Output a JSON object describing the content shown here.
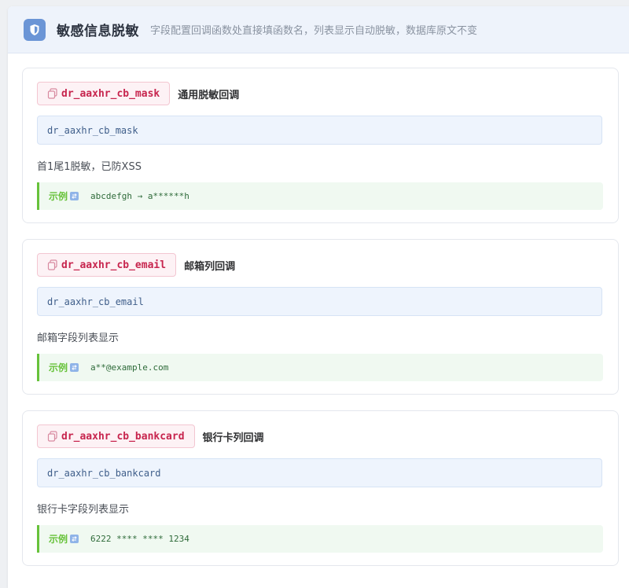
{
  "header": {
    "title": "敏感信息脱敏",
    "subtitle": "字段配置回调函数处直接填函数名，列表显示自动脱敏，数据库原文不变",
    "icon": "shield-icon",
    "accent": "#6b95d6"
  },
  "cards": [
    {
      "fn_name": "dr_aaxhr_cb_mask",
      "label": "通用脱敏回调",
      "code": "dr_aaxhr_cb_mask",
      "description": "首1尾1脱敏，已防XSS",
      "example_label": "示例",
      "example_value": "abcdefgh → a******h"
    },
    {
      "fn_name": "dr_aaxhr_cb_email",
      "label": "邮箱列回调",
      "code": "dr_aaxhr_cb_email",
      "description": "邮箱字段列表显示",
      "example_label": "示例",
      "example_value": "a**@example.com"
    },
    {
      "fn_name": "dr_aaxhr_cb_bankcard",
      "label": "银行卡列回调",
      "code": "dr_aaxhr_cb_bankcard",
      "description": "银行卡字段列表显示",
      "example_label": "示例",
      "example_value": "6222 **** **** 1234"
    }
  ]
}
